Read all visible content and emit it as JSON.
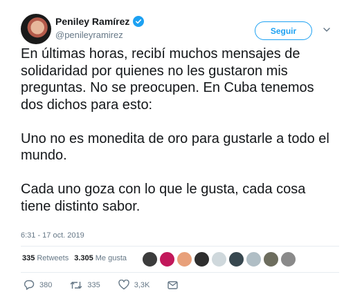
{
  "user": {
    "name": "Peniley Ramírez",
    "handle": "@penileyramirez"
  },
  "follow_label": "Seguir",
  "paragraphs": [
    "En últimas horas, recibí muchos mensajes de solidaridad por quienes no les gustaron mis preguntas. No se preocupen. En Cuba tenemos dos dichos para esto:",
    "Uno no es monedita de oro para gustarle a todo el mundo.",
    "Cada uno goza con lo que le gusta, cada cosa tiene distinto sabor."
  ],
  "timestamp": "6:31 - 17 oct. 2019",
  "stats": {
    "retweets_count": "335",
    "retweets_label": "Retweets",
    "likes_count": "3.305",
    "likes_label": "Me gusta"
  },
  "liker_avatar_colors": [
    "#3c3c3c",
    "#c2185b",
    "#e8a07a",
    "#2e2e2e",
    "#cfd8dc",
    "#37474f",
    "#b0bec5",
    "#6d6d5e",
    "#8a8a8a"
  ],
  "actions": {
    "replies": "380",
    "retweets": "335",
    "likes": "3,3K"
  },
  "colors": {
    "accent": "#1da1f2",
    "muted": "#657786",
    "text": "#14171a"
  }
}
